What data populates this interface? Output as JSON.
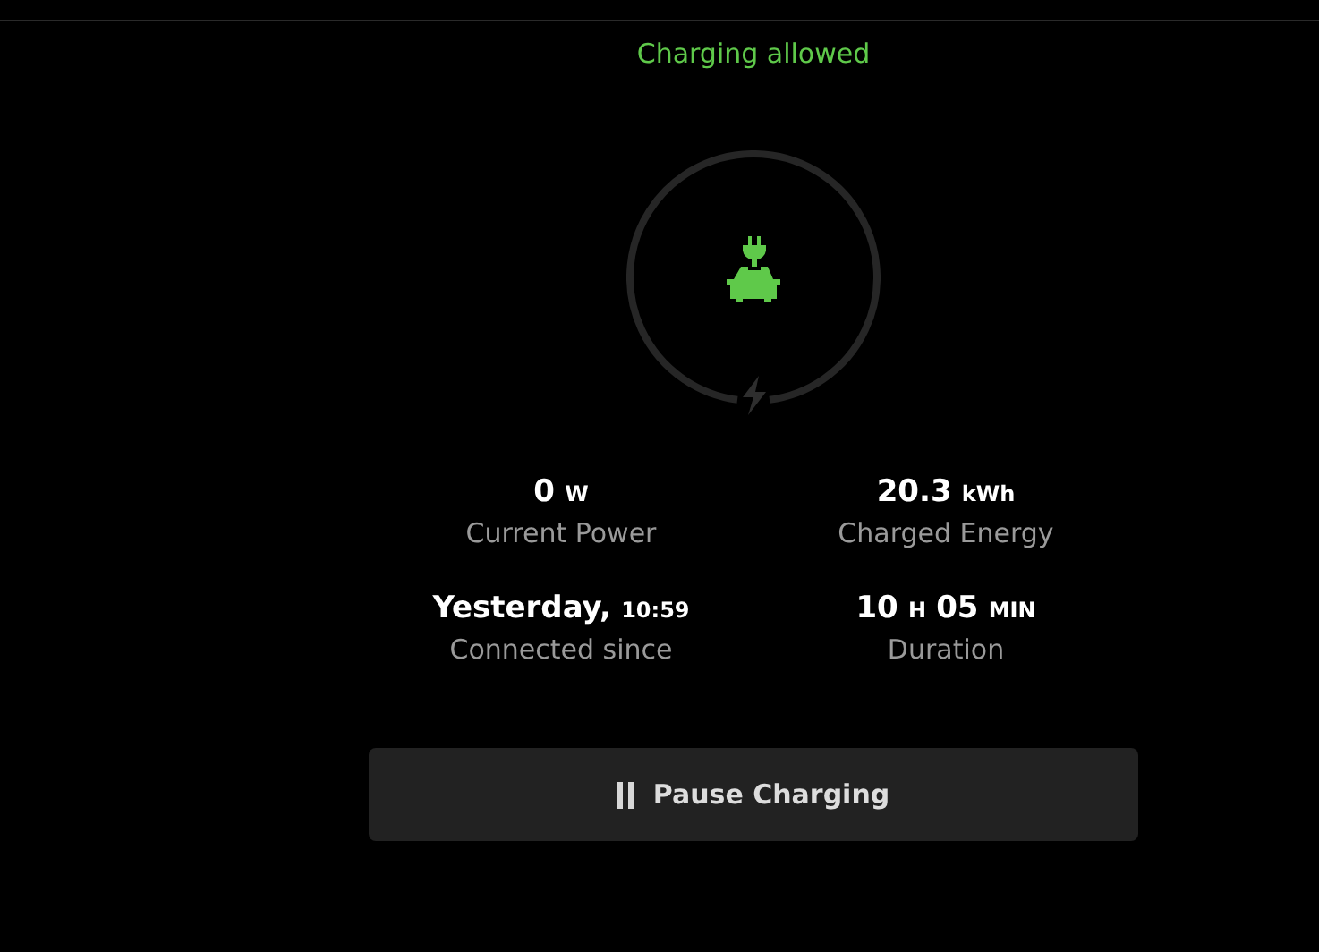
{
  "status": {
    "text": "Charging allowed",
    "color": "#5fc94a"
  },
  "stats": [
    {
      "parts": [
        {
          "kind": "big",
          "text": "0"
        },
        {
          "kind": "small",
          "text": "W"
        }
      ],
      "label": "Current Power"
    },
    {
      "parts": [
        {
          "kind": "big",
          "text": "20.3"
        },
        {
          "kind": "small",
          "text": "kWh"
        }
      ],
      "label": "Charged Energy"
    },
    {
      "parts": [
        {
          "kind": "big",
          "text": "Yesterday,"
        },
        {
          "kind": "small",
          "text": "10:59"
        }
      ],
      "label": "Connected since"
    },
    {
      "parts": [
        {
          "kind": "big",
          "text": "10"
        },
        {
          "kind": "small",
          "text": "H"
        },
        {
          "kind": "big",
          "text": "05"
        },
        {
          "kind": "small",
          "text": "MIN"
        }
      ],
      "label": "Duration"
    }
  ],
  "button": {
    "label": "Pause Charging"
  }
}
